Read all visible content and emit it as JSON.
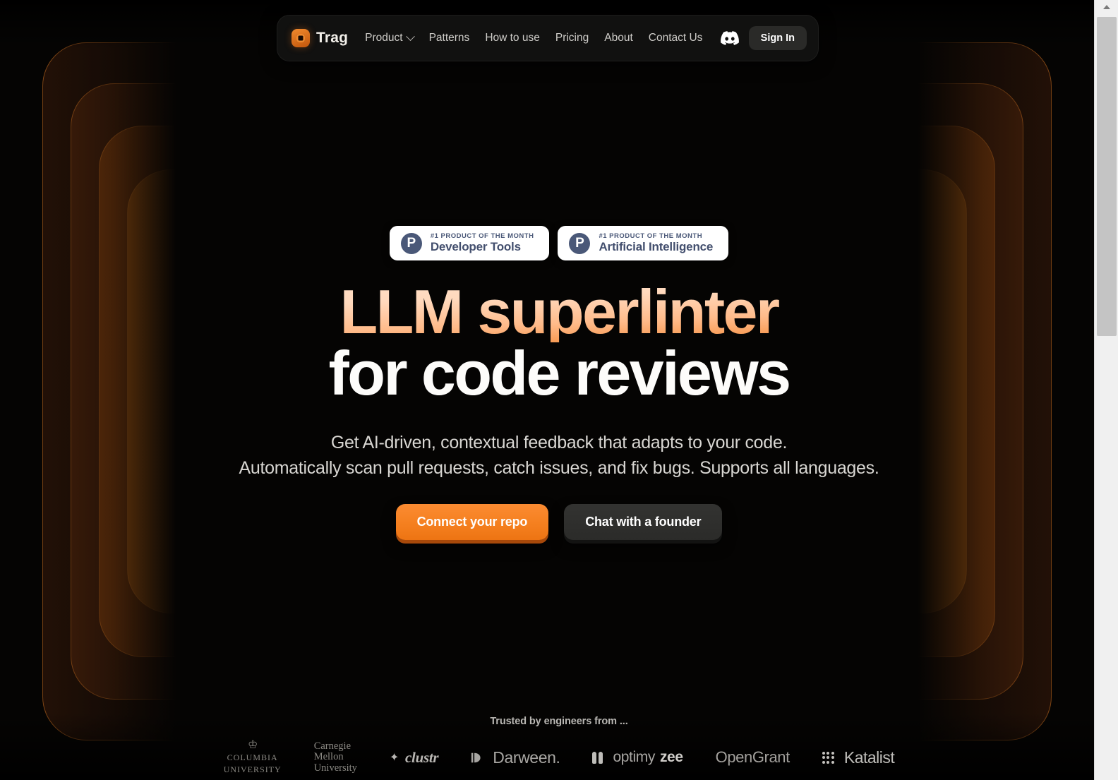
{
  "nav": {
    "brand": "Trag",
    "brand_mark_icon": "trag-logo-icon",
    "links": [
      {
        "label": "Product",
        "has_chevron": true
      },
      {
        "label": "Patterns",
        "has_chevron": false
      },
      {
        "label": "How to use",
        "has_chevron": false
      },
      {
        "label": "Pricing",
        "has_chevron": false
      },
      {
        "label": "About",
        "has_chevron": false
      },
      {
        "label": "Contact Us",
        "has_chevron": false
      }
    ],
    "discord_icon": "discord-icon",
    "sign_in": "Sign In"
  },
  "badges": [
    {
      "icon": "product-hunt-icon",
      "letter": "P",
      "kicker": "#1 PRODUCT OF THE MONTH",
      "title": "Developer Tools"
    },
    {
      "icon": "product-hunt-icon",
      "letter": "P",
      "kicker": "#1 PRODUCT OF THE MONTH",
      "title": "Artificial Intelligence"
    }
  ],
  "hero": {
    "headline_line1": "LLM superlinter",
    "headline_line2": "for code reviews",
    "subhead_line1": "Get AI-driven, contextual feedback that adapts to your code.",
    "subhead_line2": "Automatically scan pull requests, catch issues, and fix bugs. Supports all languages.",
    "cta_primary": "Connect your repo",
    "cta_secondary": "Chat with a founder"
  },
  "trusted": {
    "label": "Trusted by engineers from ...",
    "logos": [
      {
        "name": "columbia-university",
        "crown": "♔",
        "line1": "COLUMBIA",
        "line2": "UNIVERSITY"
      },
      {
        "name": "carnegie-mellon-university",
        "line1": "Carnegie",
        "line2": "Mellon",
        "line3": "University"
      },
      {
        "name": "clustr",
        "star": "✦",
        "text": "clustr"
      },
      {
        "name": "darween",
        "text": "Darween."
      },
      {
        "name": "optimyzee",
        "text_light": "optimy",
        "text_bold": "zee"
      },
      {
        "name": "opengrant",
        "text": "OpenGrant"
      },
      {
        "name": "katalist",
        "text": "Katalist"
      }
    ]
  },
  "colors": {
    "background": "#050403",
    "accent_orange": "#f5801f",
    "accent_orange_dark": "#a8490a",
    "navbar_bg": "#111110",
    "badge_blue": "#4a5878",
    "text_primary": "#fdfcfa",
    "text_muted": "#d8d6d2"
  }
}
